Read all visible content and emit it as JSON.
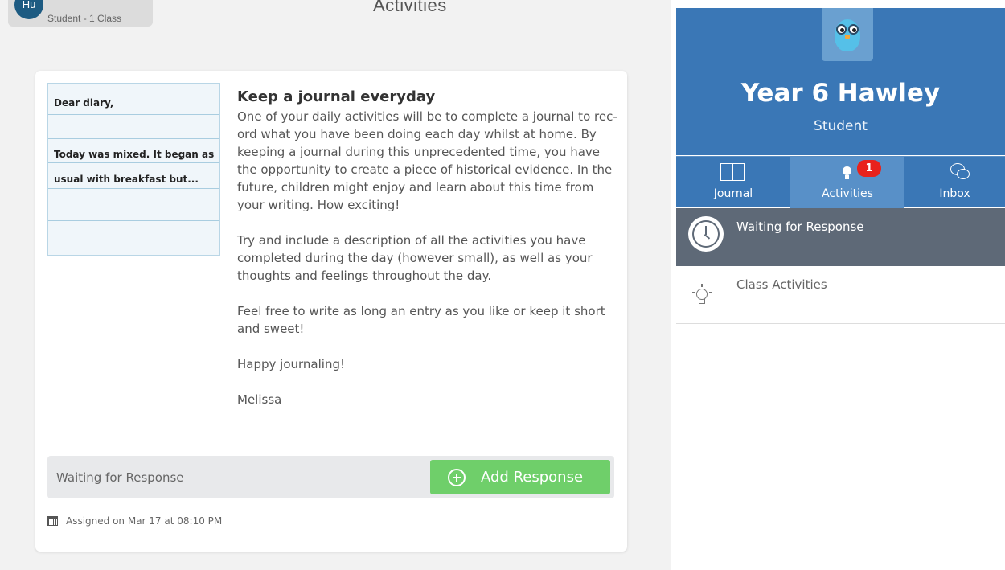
{
  "header": {
    "avatar_initials": "Hu",
    "user_subtitle": "Student - 1 Class",
    "page_title": "Activities"
  },
  "activity": {
    "diary_lines": [
      "Dear diary,",
      "Today was mixed. It began as",
      "usual with breakfast but..."
    ],
    "title": "Keep a journal everyday",
    "paragraphs": [
      "One of your daily activities will be to complete a journal to rec-ord what you have been doing each day whilst at home. By keeping a journal during this unprecedented time, you have the opportunity to create a piece of historical evidence. In the future, children might enjoy and learn about this time from your writing. How exciting!",
      "Try and include a description of all the activities you have completed during the day (however small), as well as your thoughts and feelings throughout the day.",
      "Feel free to write as long an entry as you like or keep it short and sweet!",
      "Happy journaling!",
      "Melissa"
    ],
    "response_status": "Waiting for Response",
    "add_response_label": "Add Response",
    "assigned_text": "Assigned on Mar 17 at 08:10 PM"
  },
  "sidebar": {
    "class_name": "Year 6 Hawley",
    "role": "Student",
    "tabs": [
      {
        "label": "Journal",
        "icon": "book-icon"
      },
      {
        "label": "Activities",
        "icon": "lightbulb-icon",
        "badge": "1"
      },
      {
        "label": "Inbox",
        "icon": "chat-bubbles-icon"
      }
    ],
    "menu": [
      {
        "label": "Waiting for Response",
        "icon": "clock-icon"
      },
      {
        "label": "Class Activities",
        "icon": "lightbulb-outline-icon"
      }
    ]
  },
  "colors": {
    "brand_blue": "#3a77b6",
    "active_tab": "#5890c8",
    "active_menu": "#5e6977",
    "add_button": "#6fcf6a",
    "badge_red": "#e8221c"
  }
}
